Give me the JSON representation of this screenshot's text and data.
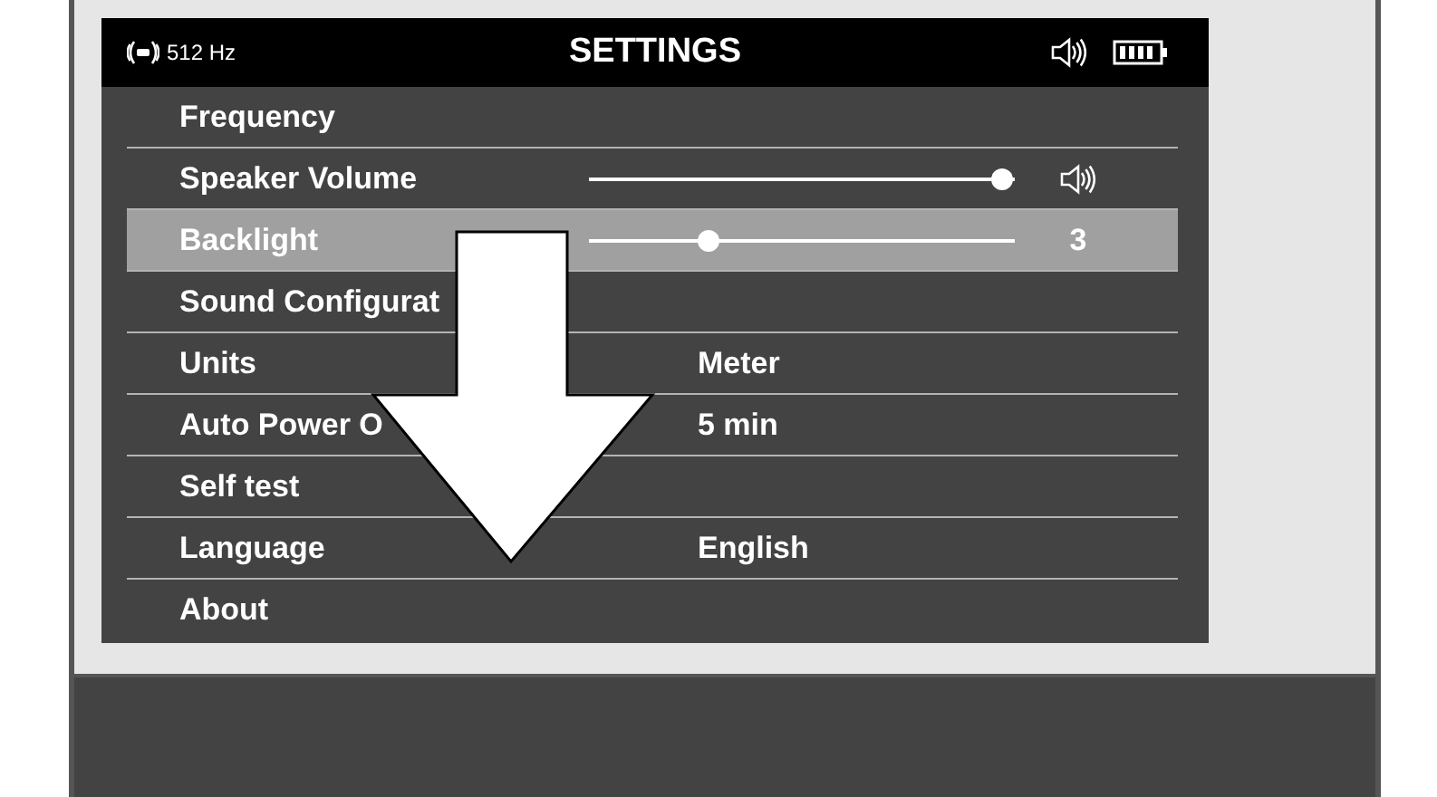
{
  "status_bar": {
    "frequency": "512 Hz",
    "title": "SETTINGS"
  },
  "rows": [
    {
      "label": "Frequency",
      "kind": "plain",
      "selected": false
    },
    {
      "label": "Speaker Volume",
      "kind": "icon-slider",
      "level": 0.97,
      "selected": false
    },
    {
      "label": "Backlight",
      "kind": "slider",
      "level": 0.28,
      "reading": "3",
      "selected": true
    },
    {
      "label": "Sound Configurat",
      "kind": "plain",
      "selected": false
    },
    {
      "label": "Units",
      "kind": "value",
      "value": "Meter",
      "selected": false
    },
    {
      "label": "Auto Power O",
      "kind": "value",
      "value": "5 min",
      "selected": false
    },
    {
      "label": "Self test",
      "kind": "plain",
      "selected": false
    },
    {
      "label": "Language",
      "kind": "value",
      "value": "English",
      "selected": false
    },
    {
      "label": "About",
      "kind": "plain",
      "selected": false
    }
  ]
}
